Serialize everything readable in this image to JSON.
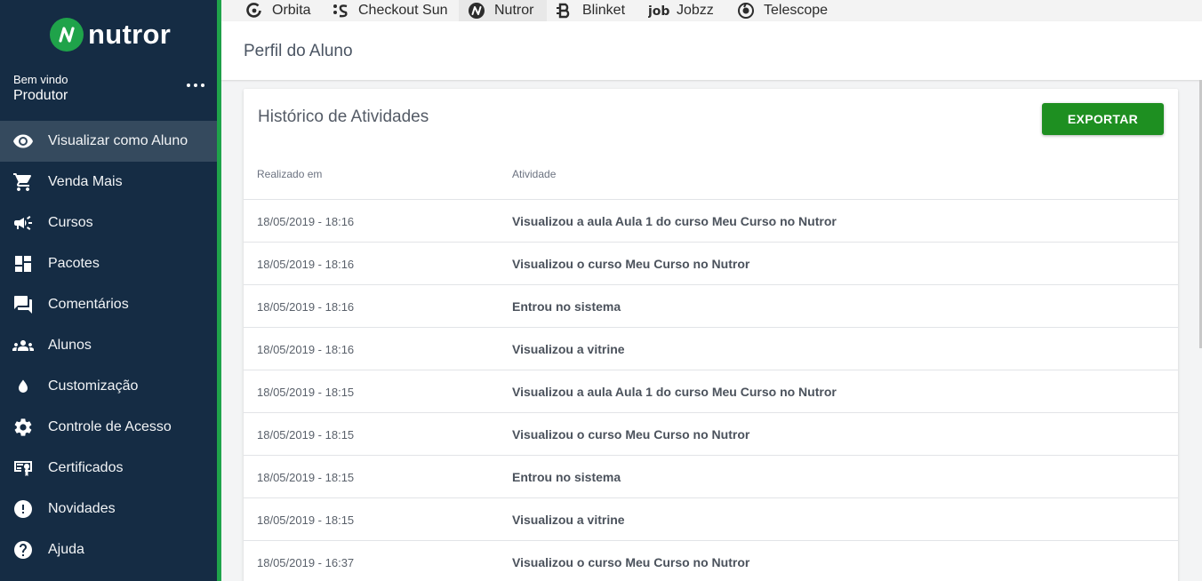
{
  "brand": {
    "name": "nutror",
    "color": "#1fa34a"
  },
  "sidebar": {
    "welcome": "Bem vindo",
    "user": "Produtor",
    "items": [
      {
        "label": "Visualizar como Aluno",
        "icon": "eye-icon",
        "active": true
      },
      {
        "label": "Venda Mais",
        "icon": "cart-icon"
      },
      {
        "label": "Cursos",
        "icon": "megaphone-icon"
      },
      {
        "label": "Pacotes",
        "icon": "dashboard-icon"
      },
      {
        "label": "Comentários",
        "icon": "comments-icon"
      },
      {
        "label": "Alunos",
        "icon": "people-icon"
      },
      {
        "label": "Customização",
        "icon": "drop-icon"
      },
      {
        "label": "Controle de Acesso",
        "icon": "gear-icon"
      },
      {
        "label": "Certificados",
        "icon": "certificate-icon"
      },
      {
        "label": "Novidades",
        "icon": "alert-icon"
      },
      {
        "label": "Ajuda",
        "icon": "help-icon"
      }
    ]
  },
  "tabs": [
    {
      "label": "Orbita",
      "icon": "orbita-icon"
    },
    {
      "label": "Checkout Sun",
      "icon": "checkout-sun-icon"
    },
    {
      "label": "Nutror",
      "icon": "nutror-icon",
      "active": true
    },
    {
      "label": "Blinket",
      "icon": "blinket-icon"
    },
    {
      "label": "Jobzz",
      "icon": "jobzz-icon"
    },
    {
      "label": "Telescope",
      "icon": "telescope-icon"
    }
  ],
  "header": {
    "title": "Perfil do Aluno"
  },
  "card": {
    "title": "Histórico de Atividades",
    "export_label": "EXPORTAR",
    "export_color": "#1e8f21",
    "columns": [
      "Realizado em",
      "Atividade"
    ],
    "rows": [
      {
        "date": "18/05/2019 - 18:16",
        "activity": "Visualizou a aula Aula 1 do curso Meu Curso no Nutror"
      },
      {
        "date": "18/05/2019 - 18:16",
        "activity": "Visualizou o curso Meu Curso no Nutror"
      },
      {
        "date": "18/05/2019 - 18:16",
        "activity": "Entrou no sistema"
      },
      {
        "date": "18/05/2019 - 18:16",
        "activity": "Visualizou a vitrine"
      },
      {
        "date": "18/05/2019 - 18:15",
        "activity": "Visualizou a aula Aula 1 do curso Meu Curso no Nutror"
      },
      {
        "date": "18/05/2019 - 18:15",
        "activity": "Visualizou o curso Meu Curso no Nutror"
      },
      {
        "date": "18/05/2019 - 18:15",
        "activity": "Entrou no sistema"
      },
      {
        "date": "18/05/2019 - 18:15",
        "activity": "Visualizou a vitrine"
      },
      {
        "date": "18/05/2019 - 16:37",
        "activity": "Visualizou o curso Meu Curso no Nutror"
      }
    ]
  }
}
